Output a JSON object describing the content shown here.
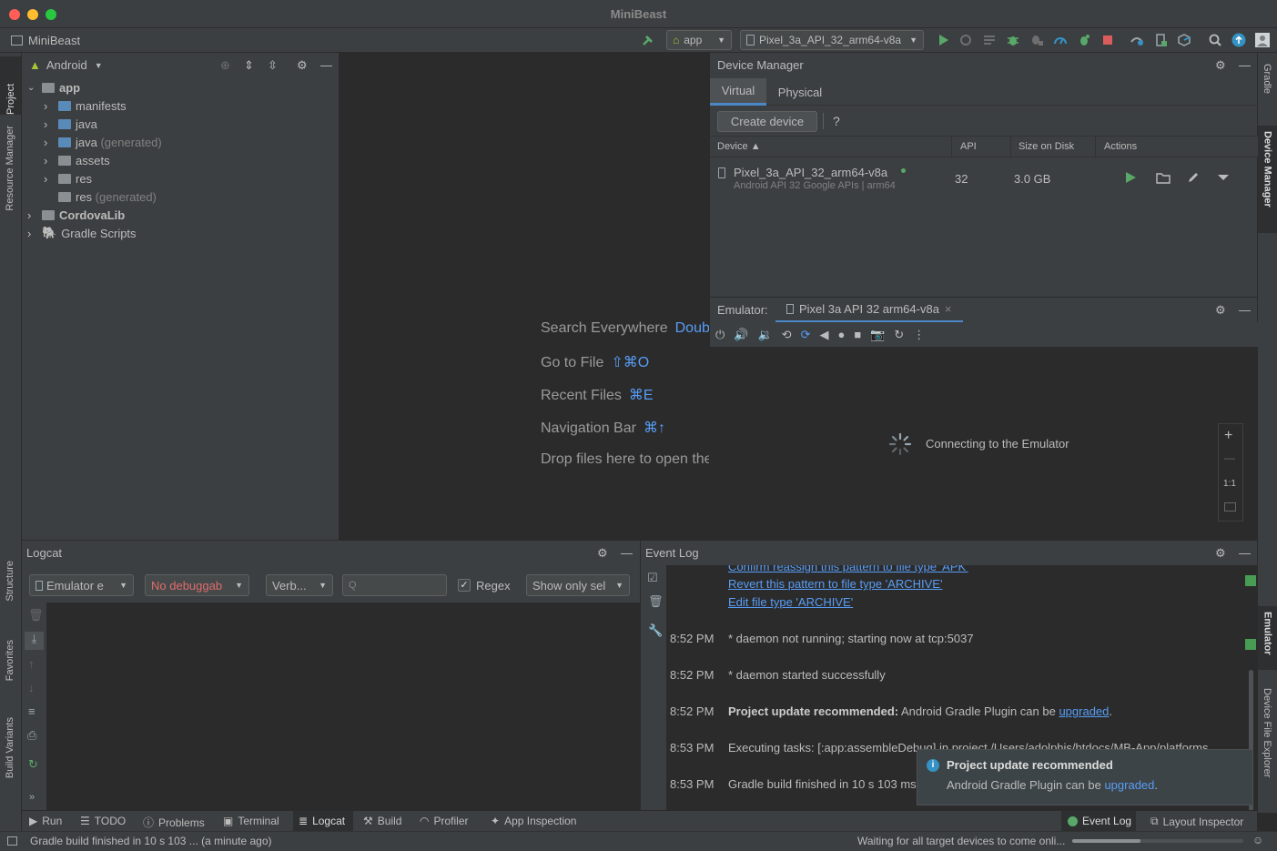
{
  "window": {
    "title": "MiniBeast"
  },
  "toolbar": {
    "project_name": "MiniBeast",
    "run_config": "app",
    "device": "Pixel_3a_API_32_arm64-v8a"
  },
  "left_stripe": {
    "project": "Project",
    "resource_manager": "Resource Manager",
    "structure": "Structure",
    "favorites": "Favorites",
    "build_variants": "Build Variants"
  },
  "right_stripe": {
    "gradle": "Gradle",
    "device_manager": "Device Manager",
    "emulator": "Emulator",
    "device_file_explorer": "Device File Explorer"
  },
  "project": {
    "view": "Android",
    "tree": [
      {
        "label": "app",
        "extra": ""
      },
      {
        "label": "manifests",
        "extra": ""
      },
      {
        "label": "java",
        "extra": ""
      },
      {
        "label": "java",
        "extra": " (generated)"
      },
      {
        "label": "assets",
        "extra": ""
      },
      {
        "label": "res",
        "extra": ""
      },
      {
        "label": "res",
        "extra": " (generated)"
      },
      {
        "label": "CordovaLib",
        "extra": ""
      },
      {
        "label": "Gradle Scripts",
        "extra": ""
      }
    ]
  },
  "editor": {
    "hints": [
      {
        "text": "Search Everywhere",
        "shortcut": "Double Shift"
      },
      {
        "text": "Go to File",
        "shortcut": "⇧⌘O"
      },
      {
        "text": "Recent Files",
        "shortcut": "⌘E"
      },
      {
        "text": "Navigation Bar",
        "shortcut": "⌘↑"
      },
      {
        "text": "Drop files here to open them",
        "shortcut": ""
      }
    ]
  },
  "device_manager": {
    "title": "Device Manager",
    "tabs": [
      "Virtual",
      "Physical"
    ],
    "create_button": "Create device",
    "help": "?",
    "columns": [
      "Device",
      "API",
      "Size on Disk",
      "Actions"
    ],
    "devices": [
      {
        "name": "Pixel_3a_API_32_arm64-v8a",
        "subtitle": "Android API 32 Google APIs | arm64",
        "api": "32",
        "size": "3.0 GB"
      }
    ]
  },
  "emulator": {
    "label": "Emulator:",
    "tab": "Pixel 3a API 32 arm64-v8a",
    "status": "Connecting to the Emulator",
    "zoom_reset": "1:1"
  },
  "logcat": {
    "title": "Logcat",
    "device_combo": "Emulator e",
    "process_combo": "No debuggab",
    "level_combo": "Verb...",
    "search_placeholder": "Q",
    "regex_label": "Regex",
    "filter_combo": "Show only sel"
  },
  "event_log": {
    "title": "Event Log",
    "links": [
      "Confirm reassign this pattern to file type 'APK'",
      "Revert this pattern to file type 'ARCHIVE'",
      "Edit file type 'ARCHIVE'"
    ],
    "entries": [
      {
        "time": "8:52 PM",
        "bold": "",
        "text": "* daemon not running; starting now at tcp:5037",
        "link": "",
        "after": ""
      },
      {
        "time": "8:52 PM",
        "bold": "",
        "text": "* daemon started successfully",
        "link": "",
        "after": ""
      },
      {
        "time": "8:52 PM",
        "bold": "Project update recommended:",
        "text": " Android Gradle Plugin can be ",
        "link": "upgraded",
        "after": "."
      },
      {
        "time": "8:53 PM",
        "bold": "",
        "text": "Executing tasks: [:app:assembleDebug] in project /Users/adolphis/htdocs/MB-App/platforms",
        "link": "",
        "after": ""
      },
      {
        "time": "8:53 PM",
        "bold": "",
        "text": "Gradle build finished in 10 s 103 ms",
        "link": "",
        "after": ""
      }
    ]
  },
  "notification": {
    "title": "Project update recommended",
    "body": "Android Gradle Plugin can be ",
    "link": "upgraded",
    "after": "."
  },
  "bottom_tabs": [
    "Run",
    "TODO",
    "Problems",
    "Terminal",
    "Logcat",
    "Build",
    "Profiler",
    "App Inspection"
  ],
  "bottom_right_tabs": [
    "Event Log",
    "Layout Inspector"
  ],
  "status": {
    "left": "Gradle build finished in 10 s 103 ... (a minute ago)",
    "right": "Waiting for all target devices to come onli..."
  }
}
